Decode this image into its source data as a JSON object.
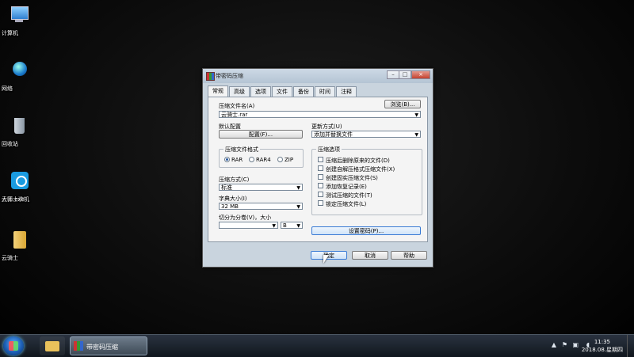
{
  "desktop": {
    "icons": [
      {
        "label": "计算机",
        "icon": "computer-icon"
      },
      {
        "label": "网络",
        "icon": "network-icon"
      },
      {
        "label": "回收站",
        "icon": "recycle-bin-icon"
      },
      {
        "label": "云骑士装机大师.exe",
        "label_line1": "云骑士装机",
        "label_line2": "大师.exe",
        "icon": "app-icon"
      },
      {
        "label": "云骑士",
        "icon": "folder-icon"
      }
    ]
  },
  "window": {
    "title": "带密码压缩",
    "title_icon": "winrar-icon",
    "controls": {
      "minimize": "–",
      "maximize": "□",
      "close": "×"
    },
    "tabs": [
      "常规",
      "高级",
      "选项",
      "文件",
      "备份",
      "时间",
      "注释"
    ],
    "active_tab": "常规",
    "general": {
      "archive_name_label": "压缩文件名(A)",
      "browse_button": "浏览(B)...",
      "archive_name_value": "云骑士.rar",
      "profiles_label": "默认配置",
      "profiles_button": "配置(F)...",
      "update_mode_label": "更新方式(U)",
      "update_mode_value": "添加并替换文件",
      "format_group": "压缩文件格式",
      "formats": [
        {
          "label": "RAR",
          "selected": true
        },
        {
          "label": "RAR4",
          "selected": false
        },
        {
          "label": "ZIP",
          "selected": false
        }
      ],
      "method_label": "压缩方式(C)",
      "method_value": "标准",
      "dict_label": "字典大小(I)",
      "dict_value": "32 MB",
      "split_label": "切分为分卷(V)，大小",
      "split_value": "",
      "split_unit": "B",
      "options_group": "压缩选项",
      "options": [
        {
          "label": "压缩后删除原来的文件(D)",
          "checked": false
        },
        {
          "label": "创建自解压格式压缩文件(X)",
          "checked": false
        },
        {
          "label": "创建固实压缩文件(S)",
          "checked": false
        },
        {
          "label": "添加恢复记录(E)",
          "checked": false
        },
        {
          "label": "测试压缩的文件(T)",
          "checked": false
        },
        {
          "label": "锁定压缩文件(L)",
          "checked": false
        }
      ],
      "set_password_button": "设置密码(P)..."
    },
    "footer": {
      "ok": "确定",
      "cancel": "取消",
      "help": "帮助"
    }
  },
  "taskbar": {
    "active_app_label": "带密码压缩",
    "time": "11:35",
    "date": "2018.08.星期四"
  },
  "colors": {
    "window_bg": "#c9d4de",
    "panel_bg": "#f4f4f4",
    "accent": "#3a7bd5"
  }
}
